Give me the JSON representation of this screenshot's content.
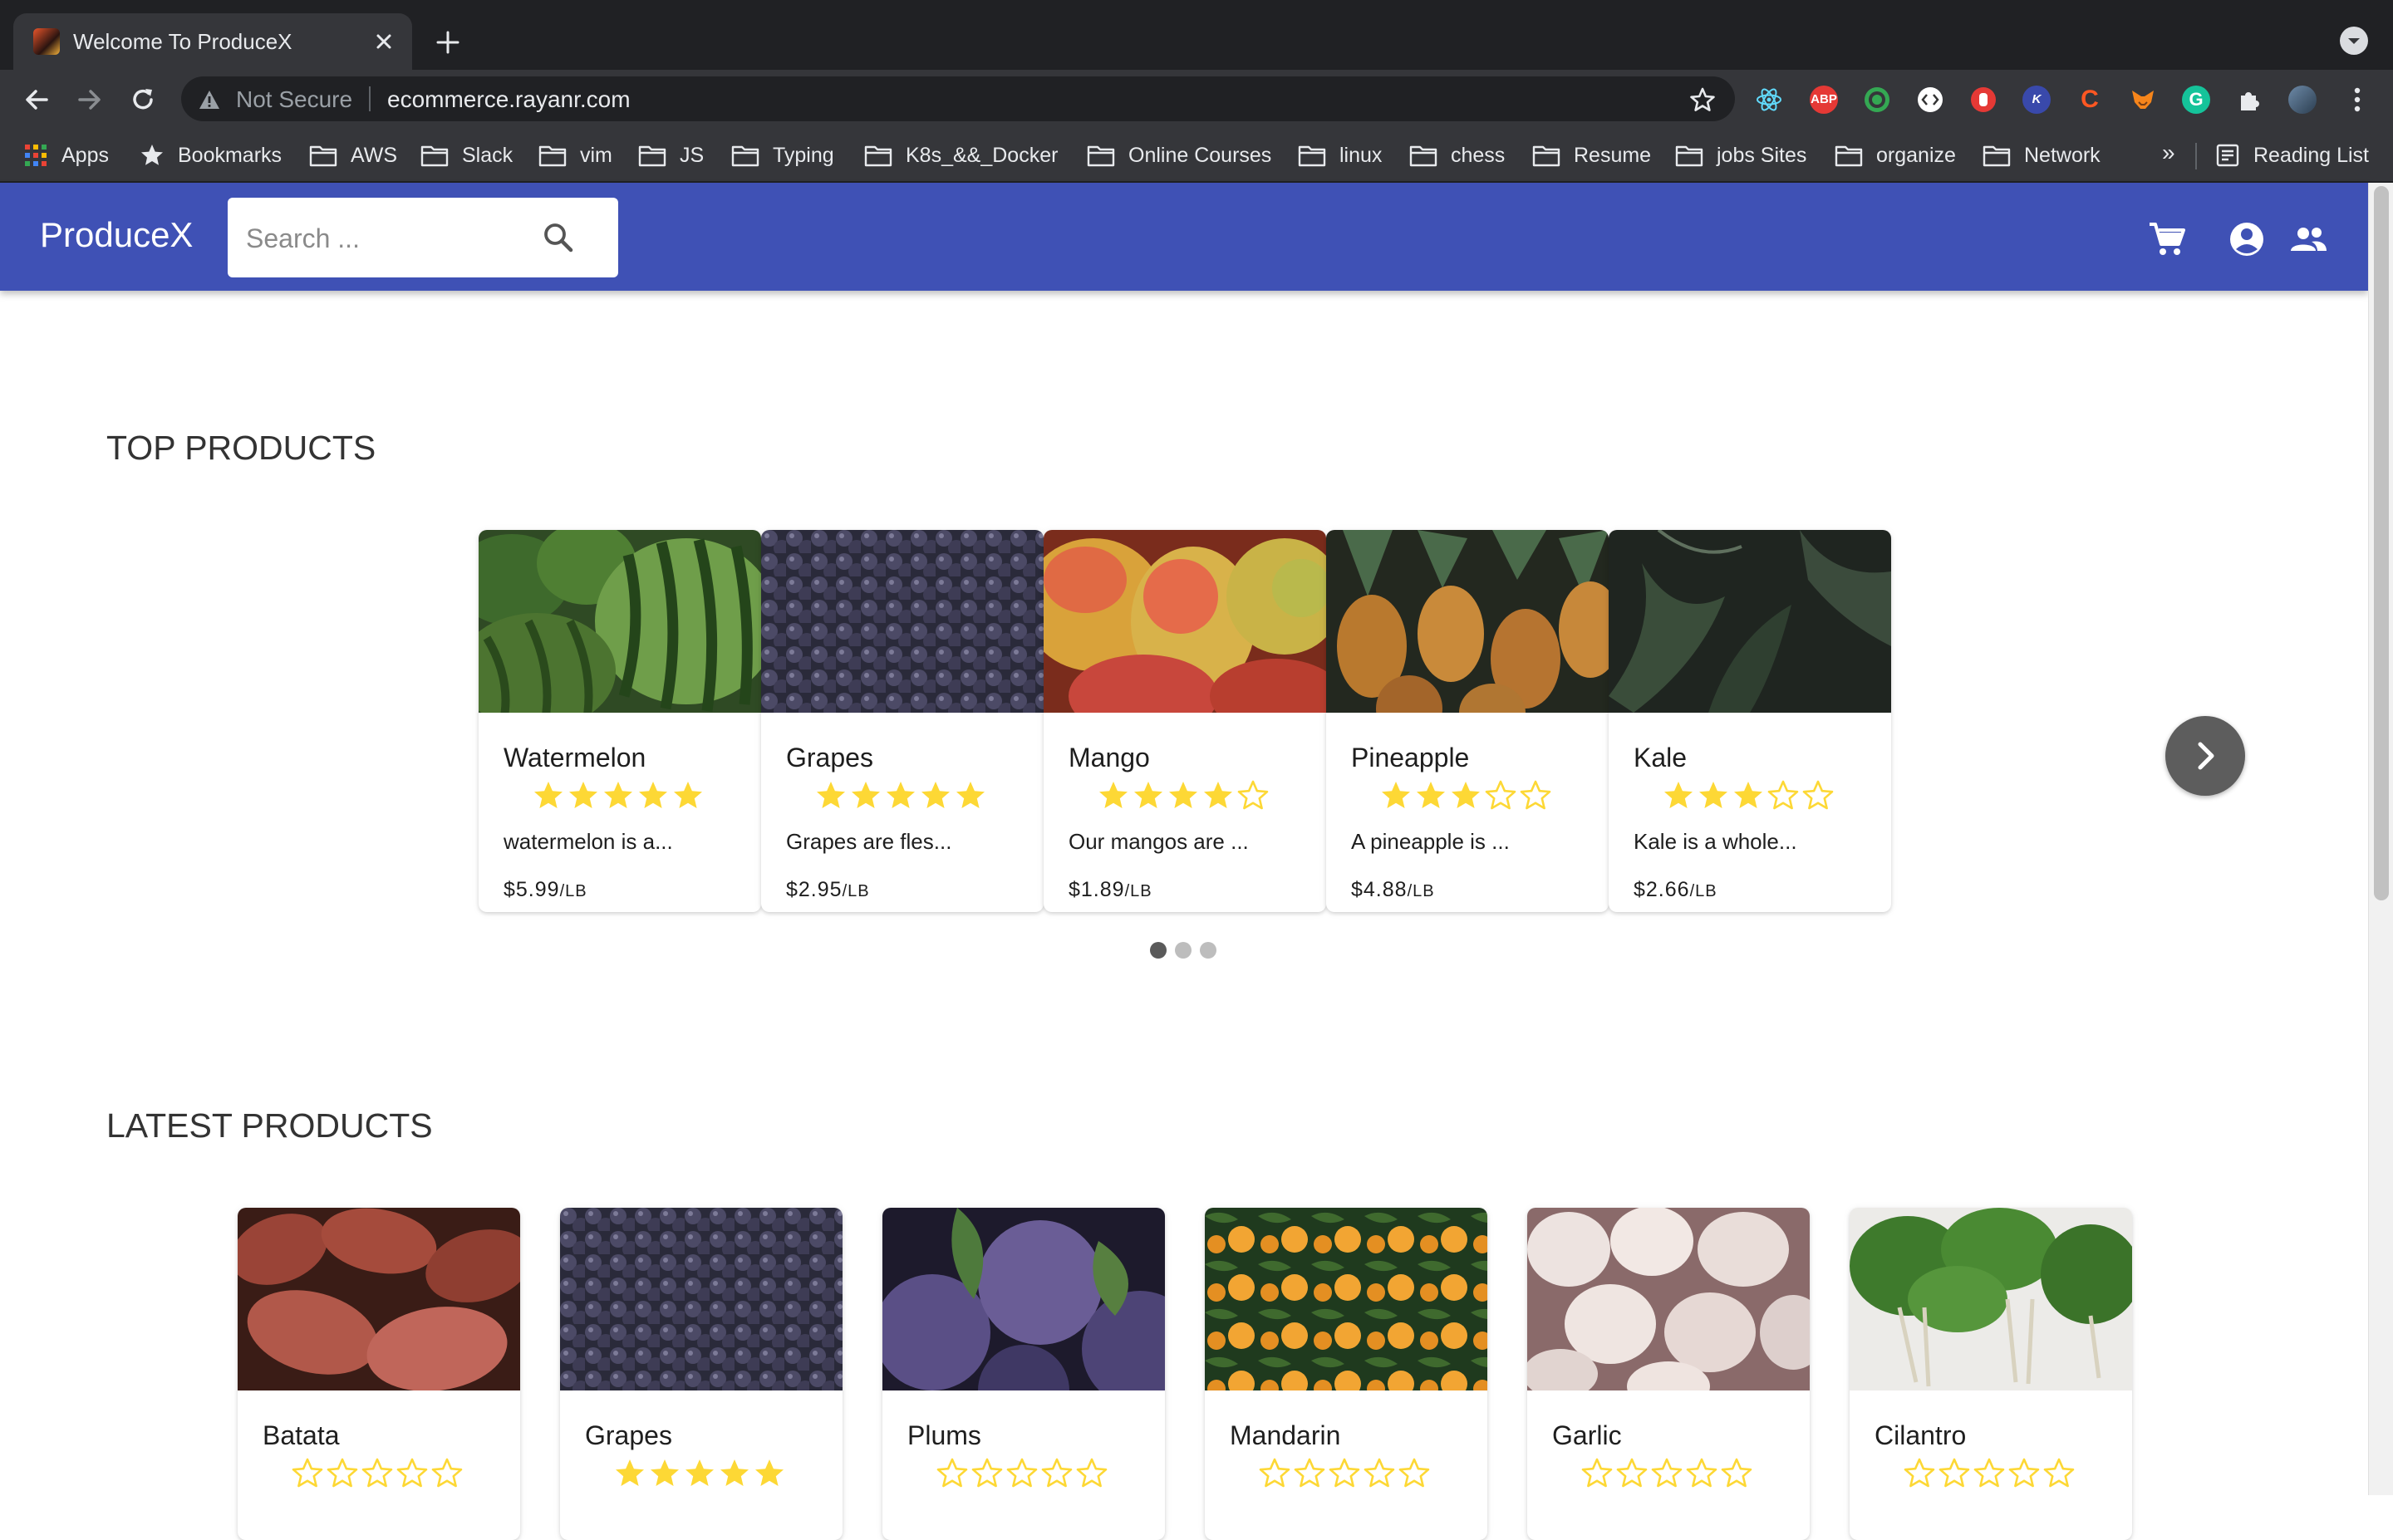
{
  "browser": {
    "tab_title": "Welcome To ProduceX",
    "security_label": "Not Secure",
    "url": "ecommerce.rayanr.com",
    "extension_labels": {
      "abp": "ABP",
      "k": "K",
      "c": "C",
      "g": "G"
    },
    "bookmarks": [
      "Apps",
      "Bookmarks",
      "AWS",
      "Slack",
      "vim",
      "JS",
      "Typing",
      "K8s_&&_Docker",
      "Online Courses",
      "linux",
      "chess",
      "Resume",
      "jobs Sites",
      "organize",
      "Network"
    ],
    "more_bookmarks": "»",
    "reading_list": "Reading List"
  },
  "app": {
    "brand": "ProduceX",
    "search_placeholder": "Search ...",
    "accent_color": "#3f51b5",
    "star_color": "#fdd835"
  },
  "top_products": {
    "title": "TOP PRODUCTS",
    "carousel_page": 1,
    "carousel_pages": 3,
    "items": [
      {
        "name": "Watermelon",
        "rating": 5,
        "description": "watermelon is a...",
        "price": "$5.99",
        "unit": "/LB"
      },
      {
        "name": "Grapes",
        "rating": 5,
        "description": "Grapes are fles...",
        "price": "$2.95",
        "unit": "/LB"
      },
      {
        "name": "Mango",
        "rating": 4,
        "description": "Our mangos are ...",
        "price": "$1.89",
        "unit": "/LB"
      },
      {
        "name": "Pineapple",
        "rating": 3,
        "description": "A pineapple is ...",
        "price": "$4.88",
        "unit": "/LB"
      },
      {
        "name": "Kale",
        "rating": 3,
        "description": "Kale is a whole...",
        "price": "$2.66",
        "unit": "/LB"
      }
    ]
  },
  "latest_products": {
    "title": "LATEST PRODUCTS",
    "items": [
      {
        "name": "Batata",
        "rating": 0
      },
      {
        "name": "Grapes",
        "rating": 5
      },
      {
        "name": "Plums",
        "rating": 0
      },
      {
        "name": "Mandarin",
        "rating": 0
      },
      {
        "name": "Garlic",
        "rating": 0
      },
      {
        "name": "Cilantro",
        "rating": 0
      }
    ]
  }
}
